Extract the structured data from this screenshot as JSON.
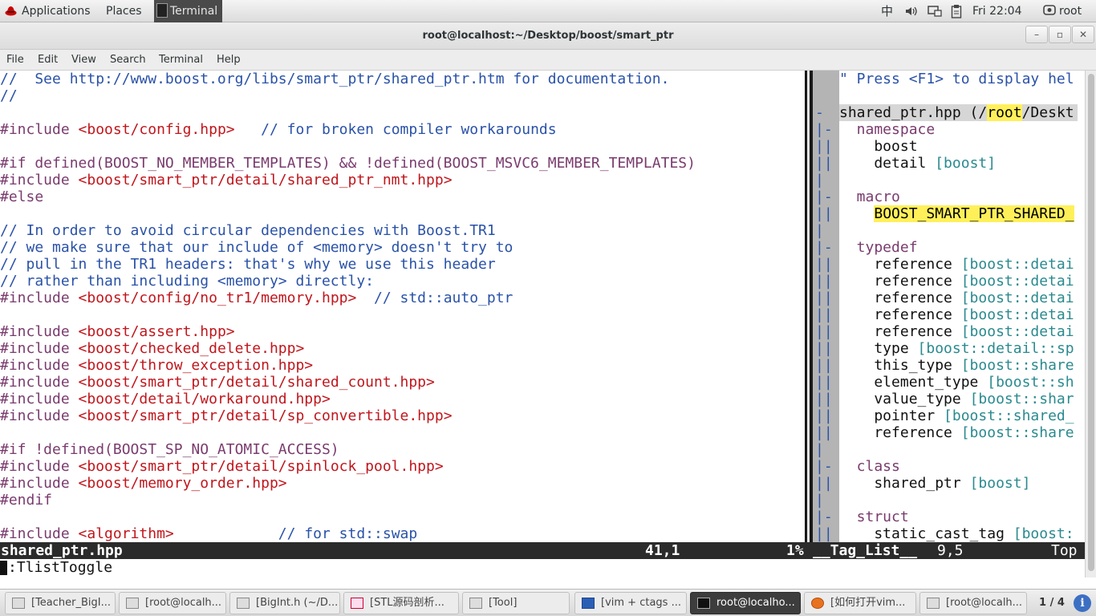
{
  "top_panel": {
    "applications": "Applications",
    "places": "Places",
    "terminal_launcher": "Terminal",
    "input_method": "中",
    "clock": "Fri 22:04",
    "user": "root"
  },
  "window": {
    "title": "root@localhost:~/Desktop/boost/smart_ptr",
    "minimize": "–",
    "maximize": "▫",
    "close": "✕"
  },
  "menu": [
    "File",
    "Edit",
    "View",
    "Search",
    "Terminal",
    "Help"
  ],
  "editor": {
    "lines": [
      [
        {
          "t": "//  See http://www.boost.org/libs/smart_ptr/shared_ptr.htm for documentation.",
          "c": "cm"
        }
      ],
      [
        {
          "t": "//",
          "c": "cm"
        }
      ],
      [],
      [
        {
          "t": "#include ",
          "c": "pp"
        },
        {
          "t": "<boost/config.hpp>",
          "c": "st"
        },
        {
          "t": "   // for broken compiler workarounds",
          "c": "cm"
        }
      ],
      [],
      [
        {
          "t": "#if defined(BOOST_NO_MEMBER_TEMPLATES) && !defined(BOOST_MSVC6_MEMBER_TEMPLATES)",
          "c": "pp"
        }
      ],
      [
        {
          "t": "#include ",
          "c": "pp"
        },
        {
          "t": "<boost/smart_ptr/detail/shared_ptr_nmt.hpp>",
          "c": "st"
        }
      ],
      [
        {
          "t": "#else",
          "c": "pp"
        }
      ],
      [],
      [
        {
          "t": "// In order to avoid circular dependencies with Boost.TR1",
          "c": "cm"
        }
      ],
      [
        {
          "t": "// we make sure that our include of <memory> doesn't try to",
          "c": "cm"
        }
      ],
      [
        {
          "t": "// pull in the TR1 headers: that's why we use this header",
          "c": "cm"
        }
      ],
      [
        {
          "t": "// rather than including <memory> directly:",
          "c": "cm"
        }
      ],
      [
        {
          "t": "#include ",
          "c": "pp"
        },
        {
          "t": "<boost/config/no_tr1/memory.hpp>",
          "c": "st"
        },
        {
          "t": "  // std::auto_ptr",
          "c": "cm"
        }
      ],
      [],
      [
        {
          "t": "#include ",
          "c": "pp"
        },
        {
          "t": "<boost/assert.hpp>",
          "c": "st"
        }
      ],
      [
        {
          "t": "#include ",
          "c": "pp"
        },
        {
          "t": "<boost/checked_delete.hpp>",
          "c": "st"
        }
      ],
      [
        {
          "t": "#include ",
          "c": "pp"
        },
        {
          "t": "<boost/throw_exception.hpp>",
          "c": "st"
        }
      ],
      [
        {
          "t": "#include ",
          "c": "pp"
        },
        {
          "t": "<boost/smart_ptr/detail/shared_count.hpp>",
          "c": "st"
        }
      ],
      [
        {
          "t": "#include ",
          "c": "pp"
        },
        {
          "t": "<boost/detail/workaround.hpp>",
          "c": "st"
        }
      ],
      [
        {
          "t": "#include ",
          "c": "pp"
        },
        {
          "t": "<boost/smart_ptr/detail/sp_convertible.hpp>",
          "c": "st"
        }
      ],
      [],
      [
        {
          "t": "#if !defined(BOOST_SP_NO_ATOMIC_ACCESS)",
          "c": "pp"
        }
      ],
      [
        {
          "t": "#include ",
          "c": "pp"
        },
        {
          "t": "<boost/smart_ptr/detail/spinlock_pool.hpp>",
          "c": "st"
        }
      ],
      [
        {
          "t": "#include ",
          "c": "pp"
        },
        {
          "t": "<boost/memory_order.hpp>",
          "c": "st"
        }
      ],
      [
        {
          "t": "#endif",
          "c": "pp"
        }
      ],
      [],
      [
        {
          "t": "#include ",
          "c": "pp"
        },
        {
          "t": "<algorithm>",
          "c": "st"
        },
        {
          "t": "            // for std::swap",
          "c": "cm"
        }
      ]
    ]
  },
  "taglist": {
    "folds": [
      "",
      "",
      "-",
      "|-",
      "||",
      "||",
      "|",
      "|-",
      "||",
      "|",
      "|-",
      "||",
      "||",
      "||",
      "||",
      "||",
      "||",
      "||",
      "||",
      "||",
      "||",
      "||",
      "|",
      "|-",
      "||",
      "|",
      "|-",
      "||"
    ],
    "lines": [
      [
        {
          "t": "\" Press <F1> to display hel",
          "c": "cm"
        }
      ],
      [],
      [
        {
          "t": "shared_ptr.hpp (/",
          "c": "tx"
        },
        {
          "t": "root",
          "c": "hl"
        },
        {
          "t": "/Deskt",
          "c": "tx"
        }
      ],
      [
        {
          "t": "  namespace",
          "c": "tl"
        }
      ],
      [
        {
          "t": "    boost",
          "c": "tx"
        }
      ],
      [
        {
          "t": "    detail ",
          "c": "tx"
        },
        {
          "t": "[boost]",
          "c": "sc"
        }
      ],
      [],
      [
        {
          "t": "  macro",
          "c": "tl"
        }
      ],
      [
        {
          "t": "    ",
          "c": "tx"
        },
        {
          "t": "BOOST_SMART_PTR_SHARED_",
          "c": "hl"
        }
      ],
      [],
      [
        {
          "t": "  typedef",
          "c": "tl"
        }
      ],
      [
        {
          "t": "    reference ",
          "c": "tx"
        },
        {
          "t": "[boost::detai",
          "c": "sc"
        }
      ],
      [
        {
          "t": "    reference ",
          "c": "tx"
        },
        {
          "t": "[boost::detai",
          "c": "sc"
        }
      ],
      [
        {
          "t": "    reference ",
          "c": "tx"
        },
        {
          "t": "[boost::detai",
          "c": "sc"
        }
      ],
      [
        {
          "t": "    reference ",
          "c": "tx"
        },
        {
          "t": "[boost::detai",
          "c": "sc"
        }
      ],
      [
        {
          "t": "    reference ",
          "c": "tx"
        },
        {
          "t": "[boost::detai",
          "c": "sc"
        }
      ],
      [
        {
          "t": "    type ",
          "c": "tx"
        },
        {
          "t": "[boost::detail::sp",
          "c": "sc"
        }
      ],
      [
        {
          "t": "    this_type ",
          "c": "tx"
        },
        {
          "t": "[boost::share",
          "c": "sc"
        }
      ],
      [
        {
          "t": "    element_type ",
          "c": "tx"
        },
        {
          "t": "[boost::sh",
          "c": "sc"
        }
      ],
      [
        {
          "t": "    value_type ",
          "c": "tx"
        },
        {
          "t": "[boost::shar",
          "c": "sc"
        }
      ],
      [
        {
          "t": "    pointer ",
          "c": "tx"
        },
        {
          "t": "[boost::shared_",
          "c": "sc"
        }
      ],
      [
        {
          "t": "    reference ",
          "c": "tx"
        },
        {
          "t": "[boost::share",
          "c": "sc"
        }
      ],
      [],
      [
        {
          "t": "  class",
          "c": "tl"
        }
      ],
      [
        {
          "t": "    shared_ptr ",
          "c": "tx"
        },
        {
          "t": "[boost]",
          "c": "sc"
        }
      ],
      [],
      [
        {
          "t": "  struct",
          "c": "tl"
        }
      ],
      [
        {
          "t": "    static_cast_tag ",
          "c": "tx"
        },
        {
          "t": "[boost:",
          "c": "sc"
        }
      ]
    ]
  },
  "status": {
    "filename": "shared_ptr.hpp",
    "position": "41,1",
    "percent": "1%",
    "tag_list": "__Tag_List__",
    "tag_position": "9,5",
    "tag_scroll": "Top"
  },
  "command_line": ":TlistToggle",
  "taskbar": {
    "tasks": [
      "[Teacher_BigI...",
      "[root@localh...",
      "[BigInt.h (~/D...",
      "[STL源码剖析...",
      "[Tool]",
      "[vim + ctags ...",
      "root@localho...",
      "[如何打开vim...",
      "[root@localh..."
    ],
    "active_index": 6,
    "pager": "1 / 4",
    "info": "i"
  }
}
